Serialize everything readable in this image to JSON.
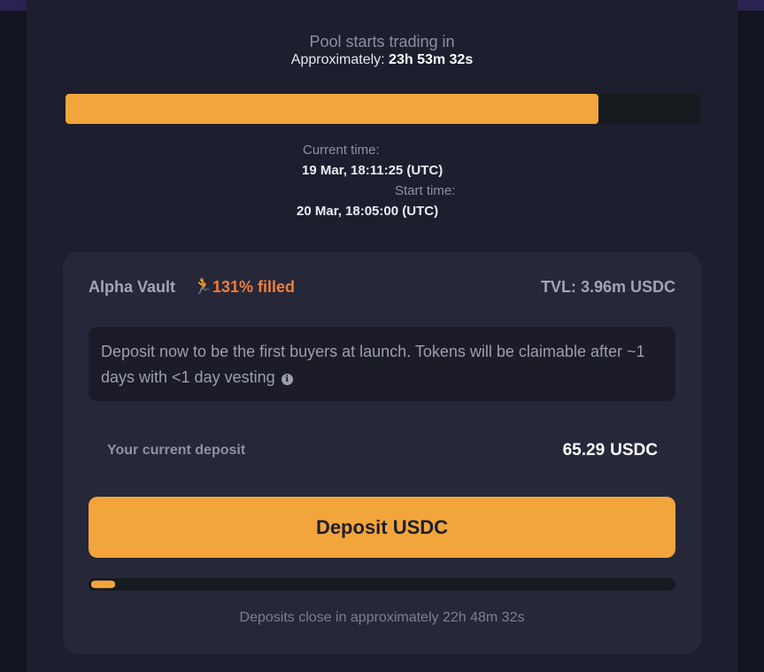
{
  "countdown": {
    "title": "Pool starts trading in",
    "approx_label": "Approximately:",
    "approx_value": "23h 53m 32s",
    "progress": 0.84
  },
  "times": {
    "current_label": "Current time:",
    "current_value": "19 Mar, 18:11:25 (UTC)",
    "start_label": "Start time:",
    "start_value": "20 Mar, 18:05:00 (UTC)"
  },
  "vault": {
    "name": "Alpha Vault",
    "runner_icon": "🏃",
    "filled": "131% filled",
    "tvl_label": "TVL:",
    "tvl_value": "3.96m USDC",
    "info_text": "Deposit now to be the first buyers at launch. Tokens will be claimable after ~1 days with <1 day vesting",
    "info_icon": "i",
    "deposit_label": "Your current deposit",
    "deposit_amount": "65.29",
    "deposit_unit": "USDC",
    "deposit_button": "Deposit USDC",
    "deposit_progress": 0.04,
    "close_text": "Deposits close in approximately 22h 48m 32s"
  },
  "colors": {
    "accent": "#f2a53b",
    "filled": "#ef7f3a",
    "panel": "#1d1e2e",
    "card": "#262738"
  }
}
